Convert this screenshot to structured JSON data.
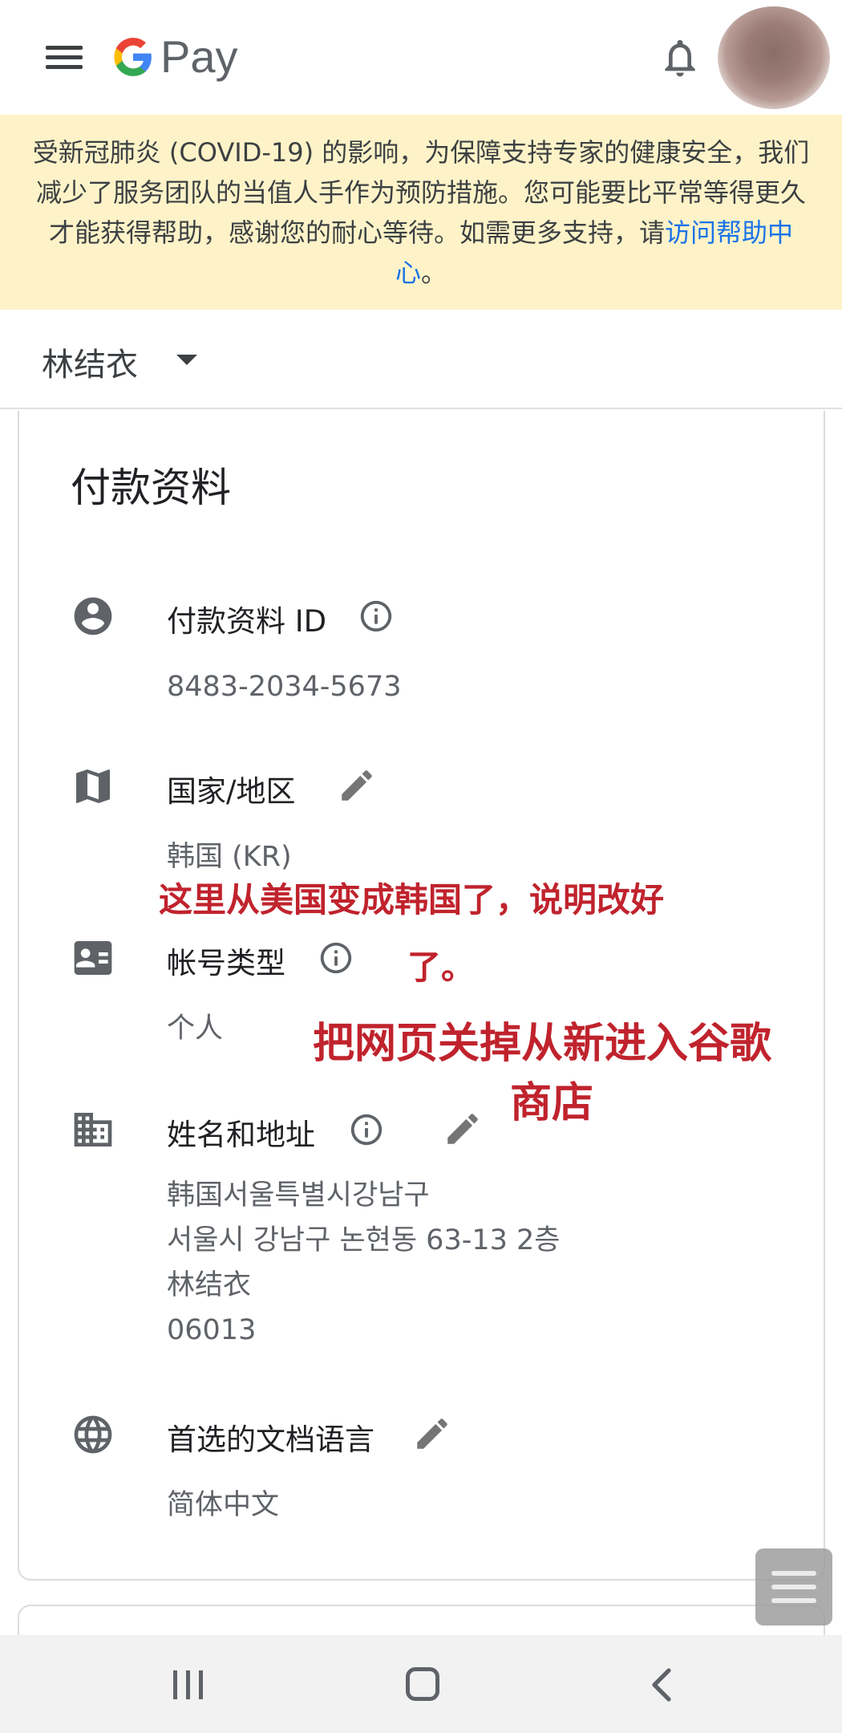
{
  "app": {
    "logo_g": "G",
    "logo_text": "Pay"
  },
  "banner": {
    "text": "受新冠肺炎 (COVID-19) 的影响，为保障支持专家的健康安全，我们减少了服务团队的当值人手作为预防措施。您可能要比平常等得更久才能获得帮助，感谢您的耐心等待。如需更多支持，请",
    "link_text": "访问帮助中心",
    "end": "。"
  },
  "account": {
    "name": "林结衣"
  },
  "profile": {
    "title": "付款资料",
    "rows": [
      {
        "label": "付款资料 ID",
        "icon": "person-icon",
        "values": [
          "8483-2034-5673"
        ]
      },
      {
        "label": "国家/地区",
        "icon": "map-icon",
        "values": [
          "韩国 (KR)"
        ]
      },
      {
        "label": "帐号类型",
        "icon": "id-card-icon",
        "values": [
          "个人"
        ]
      },
      {
        "label": "姓名和地址",
        "icon": "building-icon",
        "values": [
          "韩国서울특별시강남구",
          "서울시 강남구 논현동 63-13 2층",
          "林结衣",
          "06013"
        ]
      },
      {
        "label": "首选的文档语言",
        "icon": "globe-icon",
        "values": [
          "简体中文"
        ]
      }
    ]
  },
  "annotations": {
    "note1_line1": "这里从美国变成韩国了，说明改好",
    "note1_line2": "了。",
    "note2_line1": "把网页关掉从新进入谷歌",
    "note2_line2": "商店",
    "color": "#c0232d"
  },
  "colors": {
    "banner_bg": "#fef3c8",
    "link": "#1a73e8"
  }
}
